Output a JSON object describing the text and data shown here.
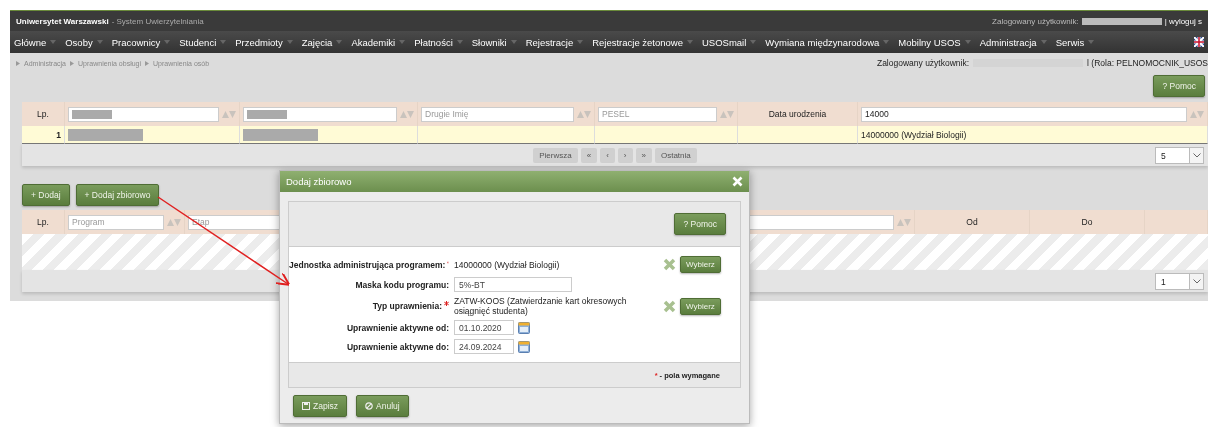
{
  "header": {
    "app_name": "Uniwersytet Warszawski",
    "subtitle": "- System Uwierzytelniania",
    "user_label": "Zalogowany użytkownik:",
    "logout": "| wyloguj s"
  },
  "menu": [
    "Główne",
    "Osoby",
    "Pracownicy",
    "Studenci",
    "Przedmioty",
    "Zajęcia",
    "Akademiki",
    "Płatności",
    "Słowniki",
    "Rejestracje",
    "Rejestracje żetonowe",
    "USOSmail",
    "Wymiana międzynarodowa",
    "Mobilny USOS",
    "Administracja",
    "Serwis"
  ],
  "breadcrumb": [
    "Administracja",
    "Uprawnienia obsługi",
    "Uprawnienia osób"
  ],
  "user_info": {
    "label": "Zalogowany użytkownik:",
    "role": "l (Rola: PELNOMOCNIK_USOS"
  },
  "help_button": "? Pomoc",
  "table1": {
    "columns": [
      {
        "kind": "label",
        "label": "Lp."
      },
      {
        "kind": "filter",
        "redacted": true
      },
      {
        "kind": "filter",
        "redacted": true
      },
      {
        "kind": "filter",
        "placeholder": "Drugie Imię"
      },
      {
        "kind": "filter",
        "placeholder": "PESEL"
      },
      {
        "kind": "label",
        "label": "Data urodzenia"
      },
      {
        "kind": "filter",
        "value": "14000"
      }
    ],
    "rows": [
      {
        "selected": true,
        "cells": [
          {
            "kind": "text",
            "text": "1"
          },
          {
            "kind": "redacted"
          },
          {
            "kind": "redacted"
          },
          {
            "kind": "empty"
          },
          {
            "kind": "empty"
          },
          {
            "kind": "empty"
          },
          {
            "kind": "text",
            "text": "14000000 (Wydział Biologii)"
          }
        ]
      }
    ],
    "pager": [
      "Pierwsza",
      "«",
      "‹",
      "›",
      "»",
      "Ostatnia"
    ],
    "page_size": "5"
  },
  "table2": {
    "actions": [
      "+ Dodaj",
      "+ Dodaj zbiorowo"
    ],
    "columns": [
      {
        "kind": "label",
        "label": "Lp."
      },
      {
        "kind": "filter",
        "placeholder": "Program"
      },
      {
        "kind": "filter",
        "placeholder": "Etap"
      },
      {
        "kind": "label",
        "label": "Od"
      },
      {
        "kind": "label",
        "label": "Do"
      },
      {
        "kind": "label"
      }
    ],
    "page_size": "1"
  },
  "dialog": {
    "title": "Dodaj zbiorowo",
    "help_button": "? Pomoc",
    "fields": [
      {
        "kind": "value",
        "label": "Jednostka administrująca programem:",
        "required": true,
        "value": "14000000 (Wydział Biologii)",
        "button": "Wybierz"
      },
      {
        "kind": "input",
        "label": "Maska kodu programu:",
        "required": false,
        "value": "5%-BT"
      },
      {
        "kind": "value",
        "label": "Typ uprawnienia:",
        "required": true,
        "value": "ZATW-KOOS (Zatwierdzanie kart okresowych osiągnięć studenta)",
        "button": "Wybierz"
      },
      {
        "kind": "date",
        "label": "Uprawnienie aktywne od:",
        "required": false,
        "value": "01.10.2020"
      },
      {
        "kind": "date",
        "label": "Uprawnienie aktywne do:",
        "required": false,
        "value": "24.09.2024"
      }
    ],
    "legend_mark": "*",
    "legend": "- pola wymagane",
    "save": "Zapisz",
    "cancel": "Anuluj"
  }
}
